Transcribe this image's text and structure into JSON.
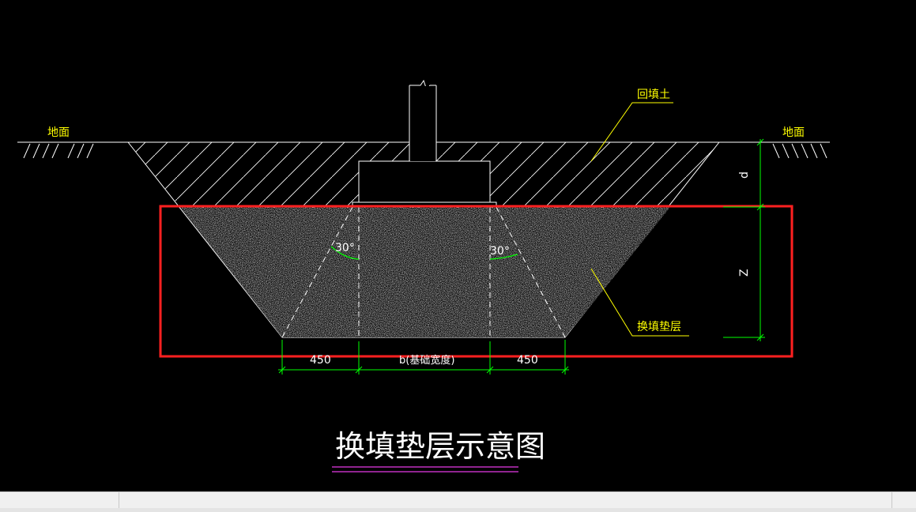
{
  "drawing": {
    "title": "换填垫层示意图",
    "ground_label_left": "地面",
    "ground_label_right": "地面",
    "backfill_label": "回填土",
    "cushion_label": "换填垫层",
    "angle_left": "30°",
    "angle_right": "30°",
    "dim_left": "450",
    "dim_center": "b(基础宽度)",
    "dim_right": "450",
    "dim_d": "d",
    "dim_z": "Z"
  },
  "colors": {
    "background": "#000000",
    "lines": "#ffffff",
    "labels": "#ffff00",
    "dimensions": "#00ff00",
    "highlight": "#ff2020",
    "title_underline": "#c030c0"
  }
}
